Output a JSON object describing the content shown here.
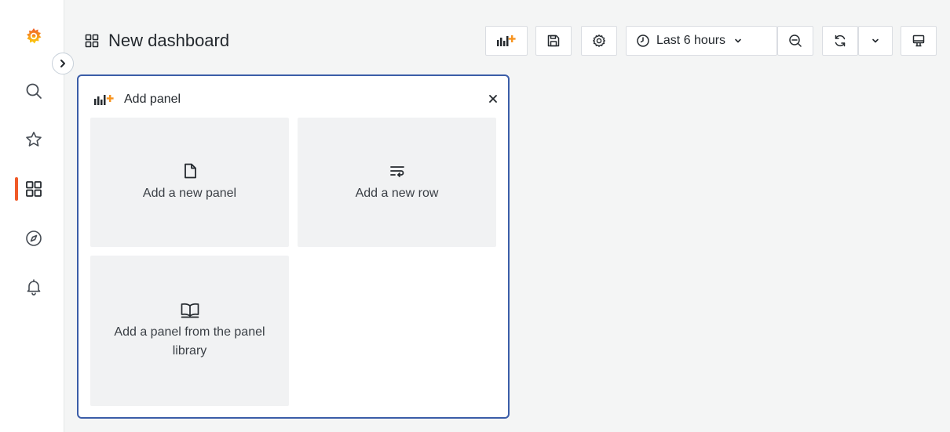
{
  "sidebar": {
    "items": [
      {
        "icon": "grafana-logo-icon"
      },
      {
        "icon": "search-icon"
      },
      {
        "icon": "star-icon"
      },
      {
        "icon": "dashboards-icon",
        "active": true
      },
      {
        "icon": "explore-compass-icon"
      },
      {
        "icon": "alerting-bell-icon"
      }
    ],
    "accent_color": "#f05a28"
  },
  "header": {
    "title": "New dashboard",
    "time_range": "Last 6 hours"
  },
  "toolbar": {
    "buttons": [
      {
        "icon": "add-panel-icon"
      },
      {
        "icon": "save-icon"
      },
      {
        "icon": "settings-gear-icon"
      },
      {
        "icon": "clock-icon"
      },
      {
        "icon": "zoom-out-icon"
      },
      {
        "icon": "refresh-icon"
      },
      {
        "icon": "chevron-down-icon"
      },
      {
        "icon": "tv-mode-icon"
      }
    ]
  },
  "add_panel": {
    "title": "Add panel",
    "border_color": "#3b5da8",
    "options": [
      {
        "label": "Add a new panel",
        "icon": "file-icon"
      },
      {
        "label": "Add a new row",
        "icon": "row-wrap-icon"
      },
      {
        "label": "Add a panel from the panel library",
        "icon": "book-icon"
      }
    ]
  }
}
